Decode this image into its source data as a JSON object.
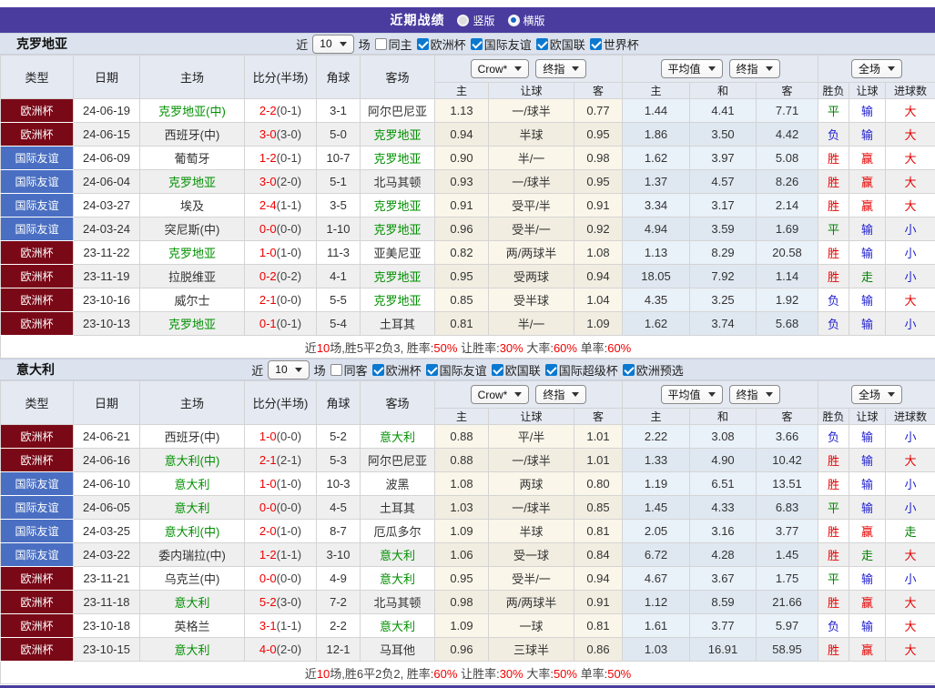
{
  "titlebar": {
    "title": "近期战绩",
    "vertical": "竖版",
    "horizontal": "横版"
  },
  "labels": {
    "near": "近",
    "matches": "场"
  },
  "head": {
    "cols": [
      "类型",
      "日期",
      "主场",
      "比分(半场)",
      "角球",
      "客场"
    ],
    "sub": [
      "主",
      "让球",
      "客",
      "主",
      "和",
      "客",
      "胜负",
      "让球",
      "进球数"
    ],
    "dd": [
      "Crow*",
      "终指",
      "平均值",
      "终指",
      "全场"
    ]
  },
  "colors": {
    "accent_purple": "#4a3c9e",
    "cup_red": "#7a0917",
    "friendly_blue": "#4a6fc2",
    "win_red": "#e60000",
    "draw_green": "#008000",
    "lose_blue": "#2020d0",
    "odds_cream": "#fbf6ea",
    "odds_blue": "#e9f1f9",
    "checkbox_blue": "#0b79d0"
  },
  "sections": [
    {
      "team": "克罗地亚",
      "filter": {
        "count": "10",
        "side": "同主",
        "leagues": [
          "欧洲杯",
          "国际友谊",
          "欧国联",
          "世界杯"
        ]
      },
      "rows": [
        {
          "league": "欧洲杯",
          "lc": "cup",
          "date": "24-06-19",
          "home": "克罗地亚(中)",
          "hg": 1,
          "score": "2-2",
          "half": "(0-1)",
          "corner": "3-1",
          "away": "阿尔巴尼亚",
          "ag": 0,
          "o1": "1.13",
          "hcap": "一/球半",
          "o2": "0.77",
          "a1": "1.44",
          "a2": "4.41",
          "a3": "7.71",
          "r1": {
            "t": "平",
            "c": "g"
          },
          "r2": {
            "t": "输",
            "c": "b"
          },
          "r3": {
            "t": "大",
            "c": "r"
          }
        },
        {
          "league": "欧洲杯",
          "lc": "cup",
          "date": "24-06-15",
          "home": "西班牙(中)",
          "hg": 0,
          "score": "3-0",
          "half": "(3-0)",
          "corner": "5-0",
          "away": "克罗地亚",
          "ag": 1,
          "o1": "0.94",
          "hcap": "半球",
          "o2": "0.95",
          "a1": "1.86",
          "a2": "3.50",
          "a3": "4.42",
          "r1": {
            "t": "负",
            "c": "b"
          },
          "r2": {
            "t": "输",
            "c": "b"
          },
          "r3": {
            "t": "大",
            "c": "r"
          }
        },
        {
          "league": "国际友谊",
          "lc": "fr",
          "date": "24-06-09",
          "home": "葡萄牙",
          "hg": 0,
          "score": "1-2",
          "half": "(0-1)",
          "corner": "10-7",
          "away": "克罗地亚",
          "ag": 1,
          "o1": "0.90",
          "hcap": "半/一",
          "o2": "0.98",
          "a1": "1.62",
          "a2": "3.97",
          "a3": "5.08",
          "r1": {
            "t": "胜",
            "c": "r"
          },
          "r2": {
            "t": "赢",
            "c": "r"
          },
          "r3": {
            "t": "大",
            "c": "r"
          }
        },
        {
          "league": "国际友谊",
          "lc": "fr",
          "date": "24-06-04",
          "home": "克罗地亚",
          "hg": 1,
          "score": "3-0",
          "half": "(2-0)",
          "corner": "5-1",
          "away": "北马其顿",
          "ag": 0,
          "o1": "0.93",
          "hcap": "一/球半",
          "o2": "0.95",
          "a1": "1.37",
          "a2": "4.57",
          "a3": "8.26",
          "r1": {
            "t": "胜",
            "c": "r"
          },
          "r2": {
            "t": "赢",
            "c": "r"
          },
          "r3": {
            "t": "大",
            "c": "r"
          }
        },
        {
          "league": "国际友谊",
          "lc": "fr",
          "date": "24-03-27",
          "home": "埃及",
          "hg": 0,
          "score": "2-4",
          "half": "(1-1)",
          "corner": "3-5",
          "away": "克罗地亚",
          "ag": 1,
          "o1": "0.91",
          "hcap": "受平/半",
          "o2": "0.91",
          "a1": "3.34",
          "a2": "3.17",
          "a3": "2.14",
          "r1": {
            "t": "胜",
            "c": "r"
          },
          "r2": {
            "t": "赢",
            "c": "r"
          },
          "r3": {
            "t": "大",
            "c": "r"
          }
        },
        {
          "league": "国际友谊",
          "lc": "fr",
          "date": "24-03-24",
          "home": "突尼斯(中)",
          "hg": 0,
          "score": "0-0",
          "half": "(0-0)",
          "corner": "1-10",
          "away": "克罗地亚",
          "ag": 1,
          "o1": "0.96",
          "hcap": "受半/一",
          "o2": "0.92",
          "a1": "4.94",
          "a2": "3.59",
          "a3": "1.69",
          "r1": {
            "t": "平",
            "c": "g"
          },
          "r2": {
            "t": "输",
            "c": "b"
          },
          "r3": {
            "t": "小",
            "c": "b"
          }
        },
        {
          "league": "欧洲杯",
          "lc": "cup",
          "date": "23-11-22",
          "home": "克罗地亚",
          "hg": 1,
          "score": "1-0",
          "half": "(1-0)",
          "corner": "11-3",
          "away": "亚美尼亚",
          "ag": 0,
          "o1": "0.82",
          "hcap": "两/两球半",
          "o2": "1.08",
          "a1": "1.13",
          "a2": "8.29",
          "a3": "20.58",
          "r1": {
            "t": "胜",
            "c": "r"
          },
          "r2": {
            "t": "输",
            "c": "b"
          },
          "r3": {
            "t": "小",
            "c": "b"
          }
        },
        {
          "league": "欧洲杯",
          "lc": "cup",
          "date": "23-11-19",
          "home": "拉脱维亚",
          "hg": 0,
          "score": "0-2",
          "half": "(0-2)",
          "corner": "4-1",
          "away": "克罗地亚",
          "ag": 1,
          "o1": "0.95",
          "hcap": "受两球",
          "o2": "0.94",
          "a1": "18.05",
          "a2": "7.92",
          "a3": "1.14",
          "r1": {
            "t": "胜",
            "c": "r"
          },
          "r2": {
            "t": "走",
            "c": "g"
          },
          "r3": {
            "t": "小",
            "c": "b"
          }
        },
        {
          "league": "欧洲杯",
          "lc": "cup",
          "date": "23-10-16",
          "home": "威尔士",
          "hg": 0,
          "score": "2-1",
          "half": "(0-0)",
          "corner": "5-5",
          "away": "克罗地亚",
          "ag": 1,
          "o1": "0.85",
          "hcap": "受半球",
          "o2": "1.04",
          "a1": "4.35",
          "a2": "3.25",
          "a3": "1.92",
          "r1": {
            "t": "负",
            "c": "b"
          },
          "r2": {
            "t": "输",
            "c": "b"
          },
          "r3": {
            "t": "大",
            "c": "r"
          }
        },
        {
          "league": "欧洲杯",
          "lc": "cup",
          "date": "23-10-13",
          "home": "克罗地亚",
          "hg": 1,
          "score": "0-1",
          "half": "(0-1)",
          "corner": "5-4",
          "away": "土耳其",
          "ag": 0,
          "o1": "0.81",
          "hcap": "半/一",
          "o2": "1.09",
          "a1": "1.62",
          "a2": "3.74",
          "a3": "5.68",
          "r1": {
            "t": "负",
            "c": "b"
          },
          "r2": {
            "t": "输",
            "c": "b"
          },
          "r3": {
            "t": "小",
            "c": "b"
          }
        }
      ],
      "summary": [
        {
          "t": "近"
        },
        {
          "t": "10",
          "r": true
        },
        {
          "t": "场,胜5平2负3, 胜率:"
        },
        {
          "t": "50%",
          "r": true
        },
        {
          "t": " 让胜率:"
        },
        {
          "t": "30%",
          "r": true
        },
        {
          "t": " 大率:"
        },
        {
          "t": "60%",
          "r": true
        },
        {
          "t": " 单率:"
        },
        {
          "t": "60%",
          "r": true
        }
      ]
    },
    {
      "team": "意大利",
      "filter": {
        "count": "10",
        "side": "同客",
        "leagues": [
          "欧洲杯",
          "国际友谊",
          "欧国联",
          "国际超级杯",
          "欧洲预选"
        ]
      },
      "rows": [
        {
          "league": "欧洲杯",
          "lc": "cup",
          "date": "24-06-21",
          "home": "西班牙(中)",
          "hg": 0,
          "score": "1-0",
          "half": "(0-0)",
          "corner": "5-2",
          "away": "意大利",
          "ag": 1,
          "o1": "0.88",
          "hcap": "平/半",
          "o2": "1.01",
          "a1": "2.22",
          "a2": "3.08",
          "a3": "3.66",
          "r1": {
            "t": "负",
            "c": "b"
          },
          "r2": {
            "t": "输",
            "c": "b"
          },
          "r3": {
            "t": "小",
            "c": "b"
          }
        },
        {
          "league": "欧洲杯",
          "lc": "cup",
          "date": "24-06-16",
          "home": "意大利(中)",
          "hg": 1,
          "score": "2-1",
          "half": "(2-1)",
          "corner": "5-3",
          "away": "阿尔巴尼亚",
          "ag": 0,
          "o1": "0.88",
          "hcap": "一/球半",
          "o2": "1.01",
          "a1": "1.33",
          "a2": "4.90",
          "a3": "10.42",
          "r1": {
            "t": "胜",
            "c": "r"
          },
          "r2": {
            "t": "输",
            "c": "b"
          },
          "r3": {
            "t": "大",
            "c": "r"
          }
        },
        {
          "league": "国际友谊",
          "lc": "fr",
          "date": "24-06-10",
          "home": "意大利",
          "hg": 1,
          "score": "1-0",
          "half": "(1-0)",
          "corner": "10-3",
          "away": "波黑",
          "ag": 0,
          "o1": "1.08",
          "hcap": "两球",
          "o2": "0.80",
          "a1": "1.19",
          "a2": "6.51",
          "a3": "13.51",
          "r1": {
            "t": "胜",
            "c": "r"
          },
          "r2": {
            "t": "输",
            "c": "b"
          },
          "r3": {
            "t": "小",
            "c": "b"
          }
        },
        {
          "league": "国际友谊",
          "lc": "fr",
          "date": "24-06-05",
          "home": "意大利",
          "hg": 1,
          "score": "0-0",
          "half": "(0-0)",
          "corner": "4-5",
          "away": "土耳其",
          "ag": 0,
          "o1": "1.03",
          "hcap": "一/球半",
          "o2": "0.85",
          "a1": "1.45",
          "a2": "4.33",
          "a3": "6.83",
          "r1": {
            "t": "平",
            "c": "g"
          },
          "r2": {
            "t": "输",
            "c": "b"
          },
          "r3": {
            "t": "小",
            "c": "b"
          }
        },
        {
          "league": "国际友谊",
          "lc": "fr",
          "date": "24-03-25",
          "home": "意大利(中)",
          "hg": 1,
          "score": "2-0",
          "half": "(1-0)",
          "corner": "8-7",
          "away": "厄瓜多尔",
          "ag": 0,
          "o1": "1.09",
          "hcap": "半球",
          "o2": "0.81",
          "a1": "2.05",
          "a2": "3.16",
          "a3": "3.77",
          "r1": {
            "t": "胜",
            "c": "r"
          },
          "r2": {
            "t": "赢",
            "c": "r"
          },
          "r3": {
            "t": "走",
            "c": "g"
          }
        },
        {
          "league": "国际友谊",
          "lc": "fr",
          "date": "24-03-22",
          "home": "委内瑞拉(中)",
          "hg": 0,
          "score": "1-2",
          "half": "(1-1)",
          "corner": "3-10",
          "away": "意大利",
          "ag": 1,
          "o1": "1.06",
          "hcap": "受一球",
          "o2": "0.84",
          "a1": "6.72",
          "a2": "4.28",
          "a3": "1.45",
          "r1": {
            "t": "胜",
            "c": "r"
          },
          "r2": {
            "t": "走",
            "c": "g"
          },
          "r3": {
            "t": "大",
            "c": "r"
          }
        },
        {
          "league": "欧洲杯",
          "lc": "cup",
          "date": "23-11-21",
          "home": "乌克兰(中)",
          "hg": 0,
          "score": "0-0",
          "half": "(0-0)",
          "corner": "4-9",
          "away": "意大利",
          "ag": 1,
          "o1": "0.95",
          "hcap": "受半/一",
          "o2": "0.94",
          "a1": "4.67",
          "a2": "3.67",
          "a3": "1.75",
          "r1": {
            "t": "平",
            "c": "g"
          },
          "r2": {
            "t": "输",
            "c": "b"
          },
          "r3": {
            "t": "小",
            "c": "b"
          }
        },
        {
          "league": "欧洲杯",
          "lc": "cup",
          "date": "23-11-18",
          "home": "意大利",
          "hg": 1,
          "score": "5-2",
          "half": "(3-0)",
          "corner": "7-2",
          "away": "北马其顿",
          "ag": 0,
          "o1": "0.98",
          "hcap": "两/两球半",
          "o2": "0.91",
          "a1": "1.12",
          "a2": "8.59",
          "a3": "21.66",
          "r1": {
            "t": "胜",
            "c": "r"
          },
          "r2": {
            "t": "赢",
            "c": "r"
          },
          "r3": {
            "t": "大",
            "c": "r"
          }
        },
        {
          "league": "欧洲杯",
          "lc": "cup",
          "date": "23-10-18",
          "home": "英格兰",
          "hg": 0,
          "score": "3-1",
          "half": "(1-1)",
          "corner": "2-2",
          "away": "意大利",
          "ag": 1,
          "o1": "1.09",
          "hcap": "一球",
          "o2": "0.81",
          "a1": "1.61",
          "a2": "3.77",
          "a3": "5.97",
          "r1": {
            "t": "负",
            "c": "b"
          },
          "r2": {
            "t": "输",
            "c": "b"
          },
          "r3": {
            "t": "大",
            "c": "r"
          }
        },
        {
          "league": "欧洲杯",
          "lc": "cup",
          "date": "23-10-15",
          "home": "意大利",
          "hg": 1,
          "score": "4-0",
          "half": "(2-0)",
          "corner": "12-1",
          "away": "马耳他",
          "ag": 0,
          "o1": "0.96",
          "hcap": "三球半",
          "o2": "0.86",
          "a1": "1.03",
          "a2": "16.91",
          "a3": "58.95",
          "r1": {
            "t": "胜",
            "c": "r"
          },
          "r2": {
            "t": "赢",
            "c": "r"
          },
          "r3": {
            "t": "大",
            "c": "r"
          }
        }
      ],
      "summary": [
        {
          "t": "近"
        },
        {
          "t": "10",
          "r": true
        },
        {
          "t": "场,胜6平2负2, 胜率:"
        },
        {
          "t": "60%",
          "r": true
        },
        {
          "t": " 让胜率:"
        },
        {
          "t": "30%",
          "r": true
        },
        {
          "t": " 大率:"
        },
        {
          "t": "50%",
          "r": true
        },
        {
          "t": " 单率:"
        },
        {
          "t": "50%",
          "r": true
        }
      ]
    }
  ]
}
